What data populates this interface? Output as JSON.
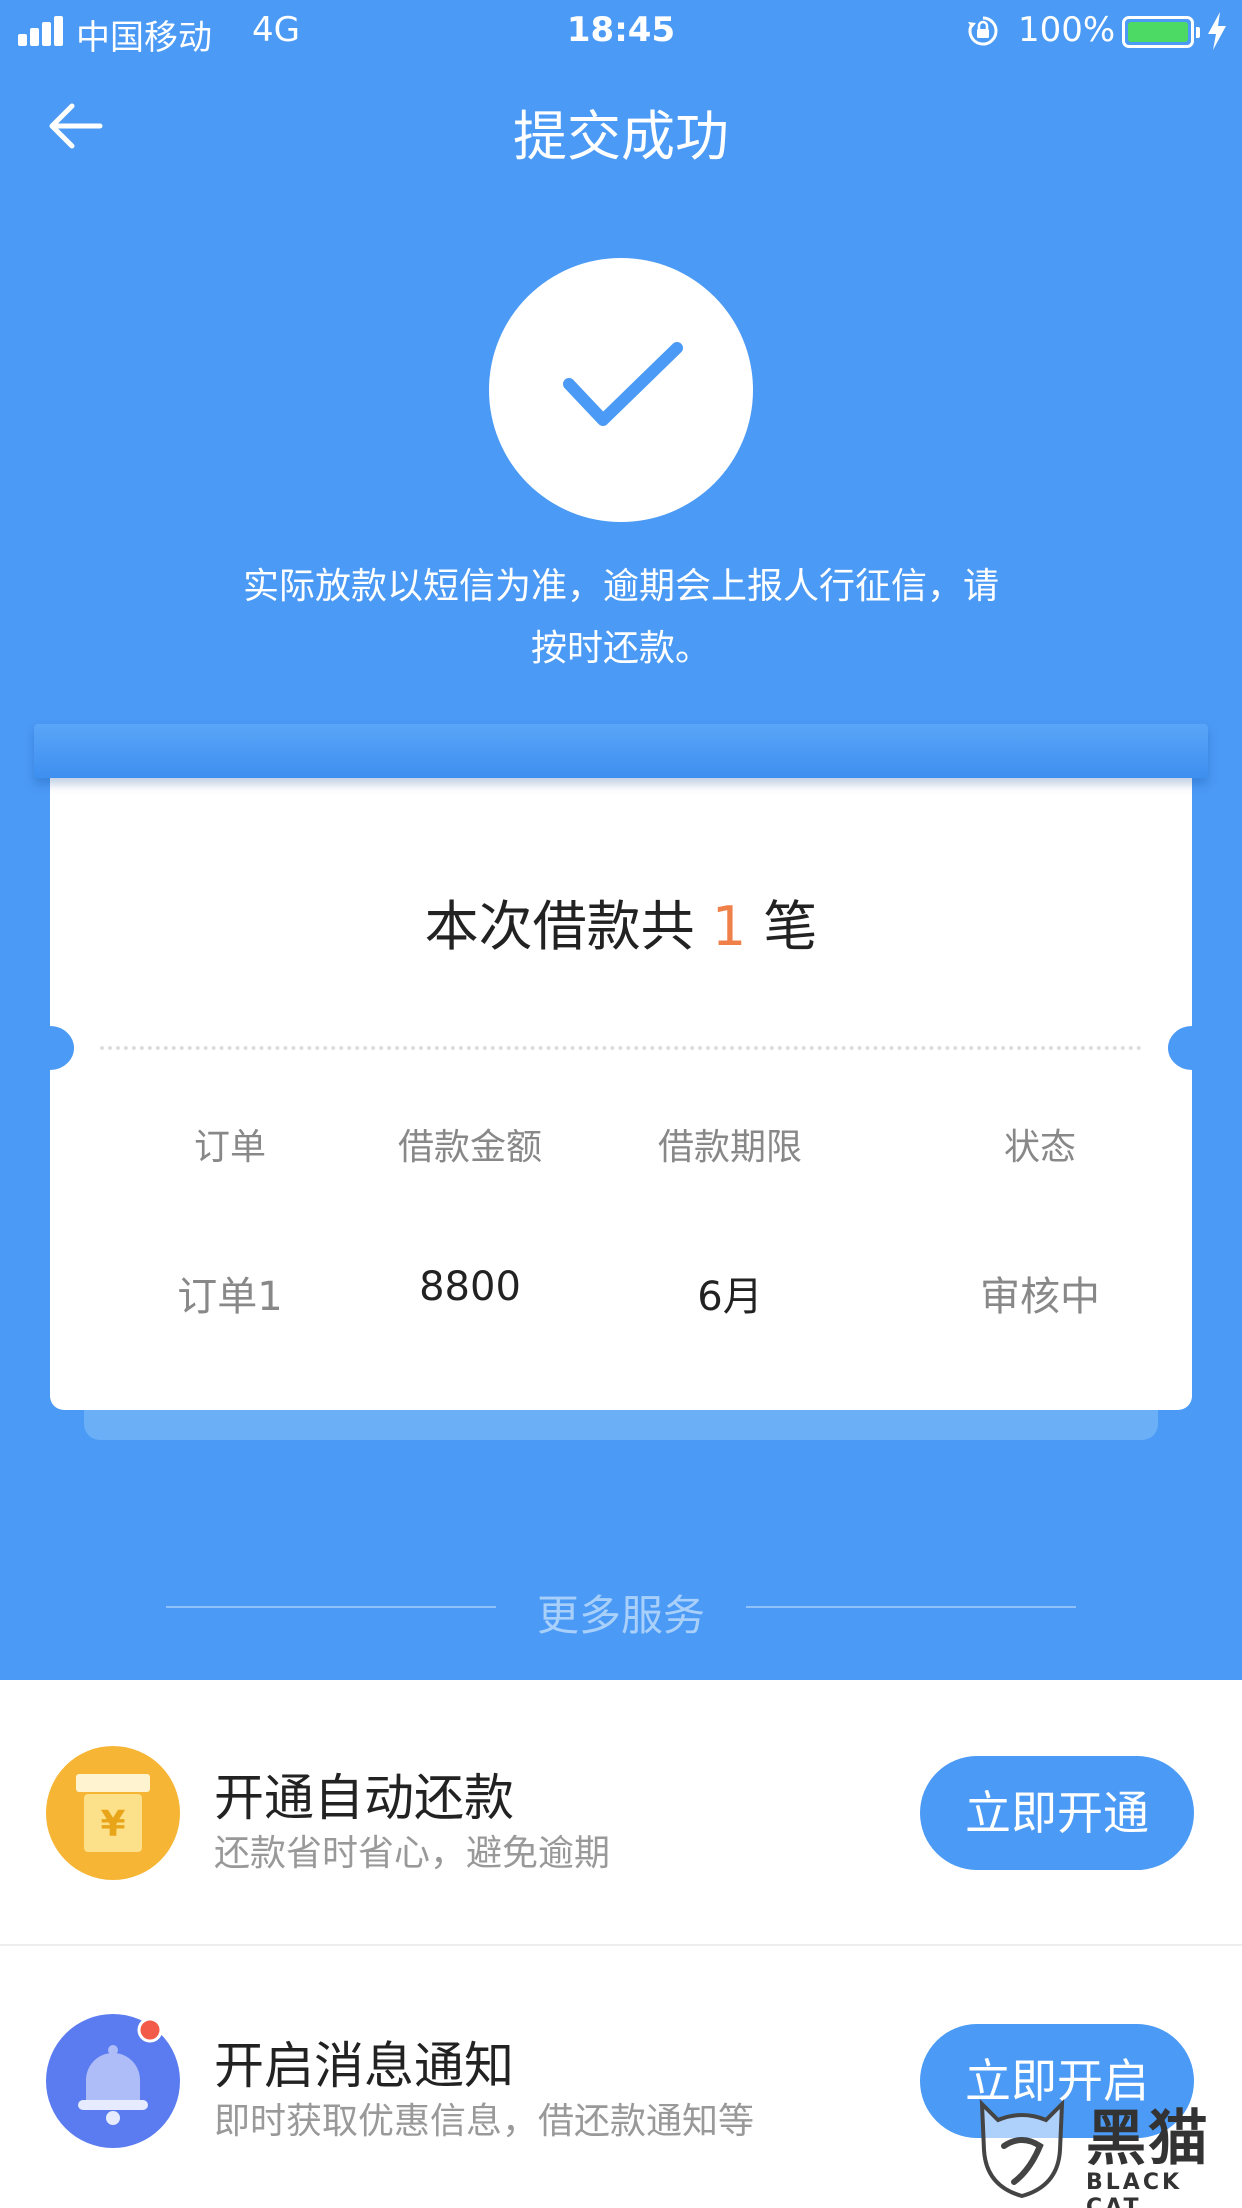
{
  "status_bar": {
    "carrier": "中国移动",
    "network": "4G",
    "time": "18:45",
    "battery": "100%"
  },
  "nav": {
    "title": "提交成功"
  },
  "notice": {
    "line1": "实际放款以短信为准，逾期会上报人行征信，请",
    "line2": "按时还款。"
  },
  "loan_card": {
    "title_prefix": "本次借款共",
    "count": "1",
    "title_suffix": "笔",
    "headers": [
      "订单",
      "借款金额",
      "借款期限",
      "状态"
    ],
    "row": [
      "订单1",
      "8800",
      "6月",
      "审核中"
    ]
  },
  "more_services": {
    "title": "更多服务",
    "items": [
      {
        "title": "开通自动还款",
        "subtitle": "还款省时省心，避免逾期",
        "button": "立即开通",
        "icon": "yuan-box-icon"
      },
      {
        "title": "开启消息通知",
        "subtitle": "即时获取优惠信息，借还款通知等",
        "button": "立即开启",
        "icon": "bell-icon"
      }
    ]
  },
  "watermark": {
    "cn": "黑猫",
    "en": "BLACK CAT"
  },
  "colors": {
    "primary_blue": "#4b9af5",
    "accent_orange": "#f0804a",
    "battery_green": "#4cd964"
  }
}
